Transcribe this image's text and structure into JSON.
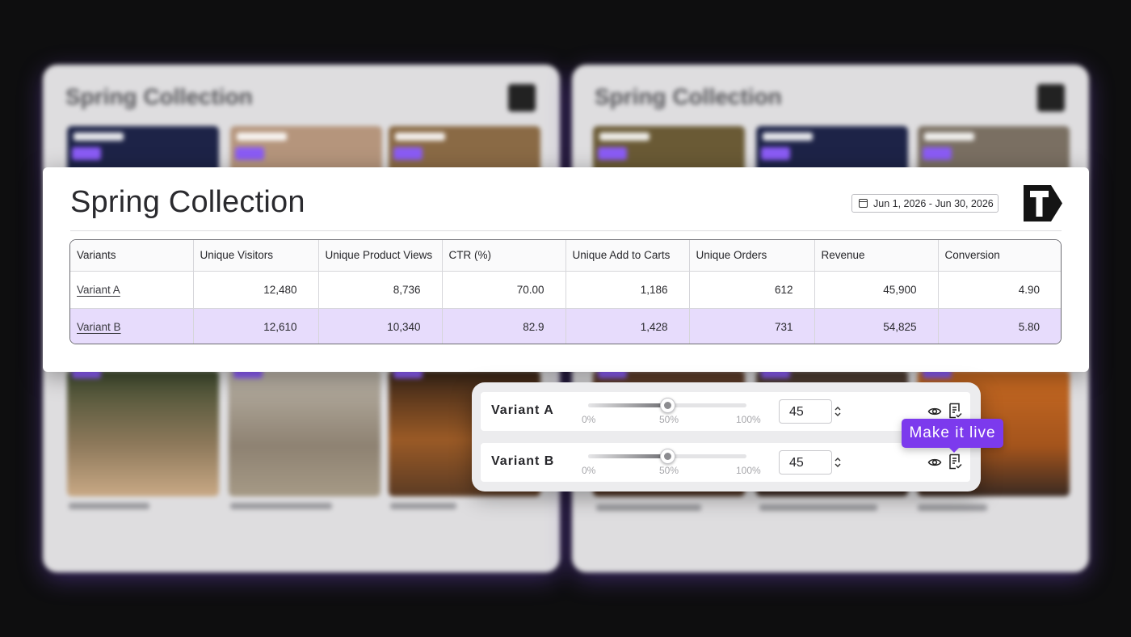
{
  "background": {
    "left_panel": {
      "title": "Spring Collection"
    },
    "right_panel": {
      "title": "Spring Collection"
    }
  },
  "card": {
    "title": "Spring Collection",
    "date_range": "Jun 1, 2026 - Jun 30, 2026",
    "logo_icon": "brand-t-tag-icon"
  },
  "table": {
    "columns": [
      "Variants",
      "Unique Visitors",
      "Unique Product Views",
      "CTR (%)",
      "Unique Add to Carts",
      "Unique Orders",
      "Revenue",
      "Conversion"
    ],
    "rows": [
      [
        "Variant A",
        "12,480",
        "8,736",
        "70.00",
        "1,186",
        "612",
        "45,900",
        "4.90"
      ],
      [
        "Variant B",
        "12,610",
        "10,340",
        "82.9",
        "1,428",
        "731",
        "54,825",
        "5.80"
      ]
    ]
  },
  "sliders": {
    "tick_labels": [
      "0%",
      "50%",
      "100%"
    ],
    "rows": [
      {
        "label": "Variant A",
        "value": "45",
        "slider_fraction": 0.5
      },
      {
        "label": "Variant B",
        "value": "45",
        "slider_fraction": 0.5
      }
    ]
  },
  "tooltip": {
    "text": "Make it live"
  },
  "colors": {
    "accent": "#7c3aed",
    "highlight_row": "#e7dcfc"
  }
}
